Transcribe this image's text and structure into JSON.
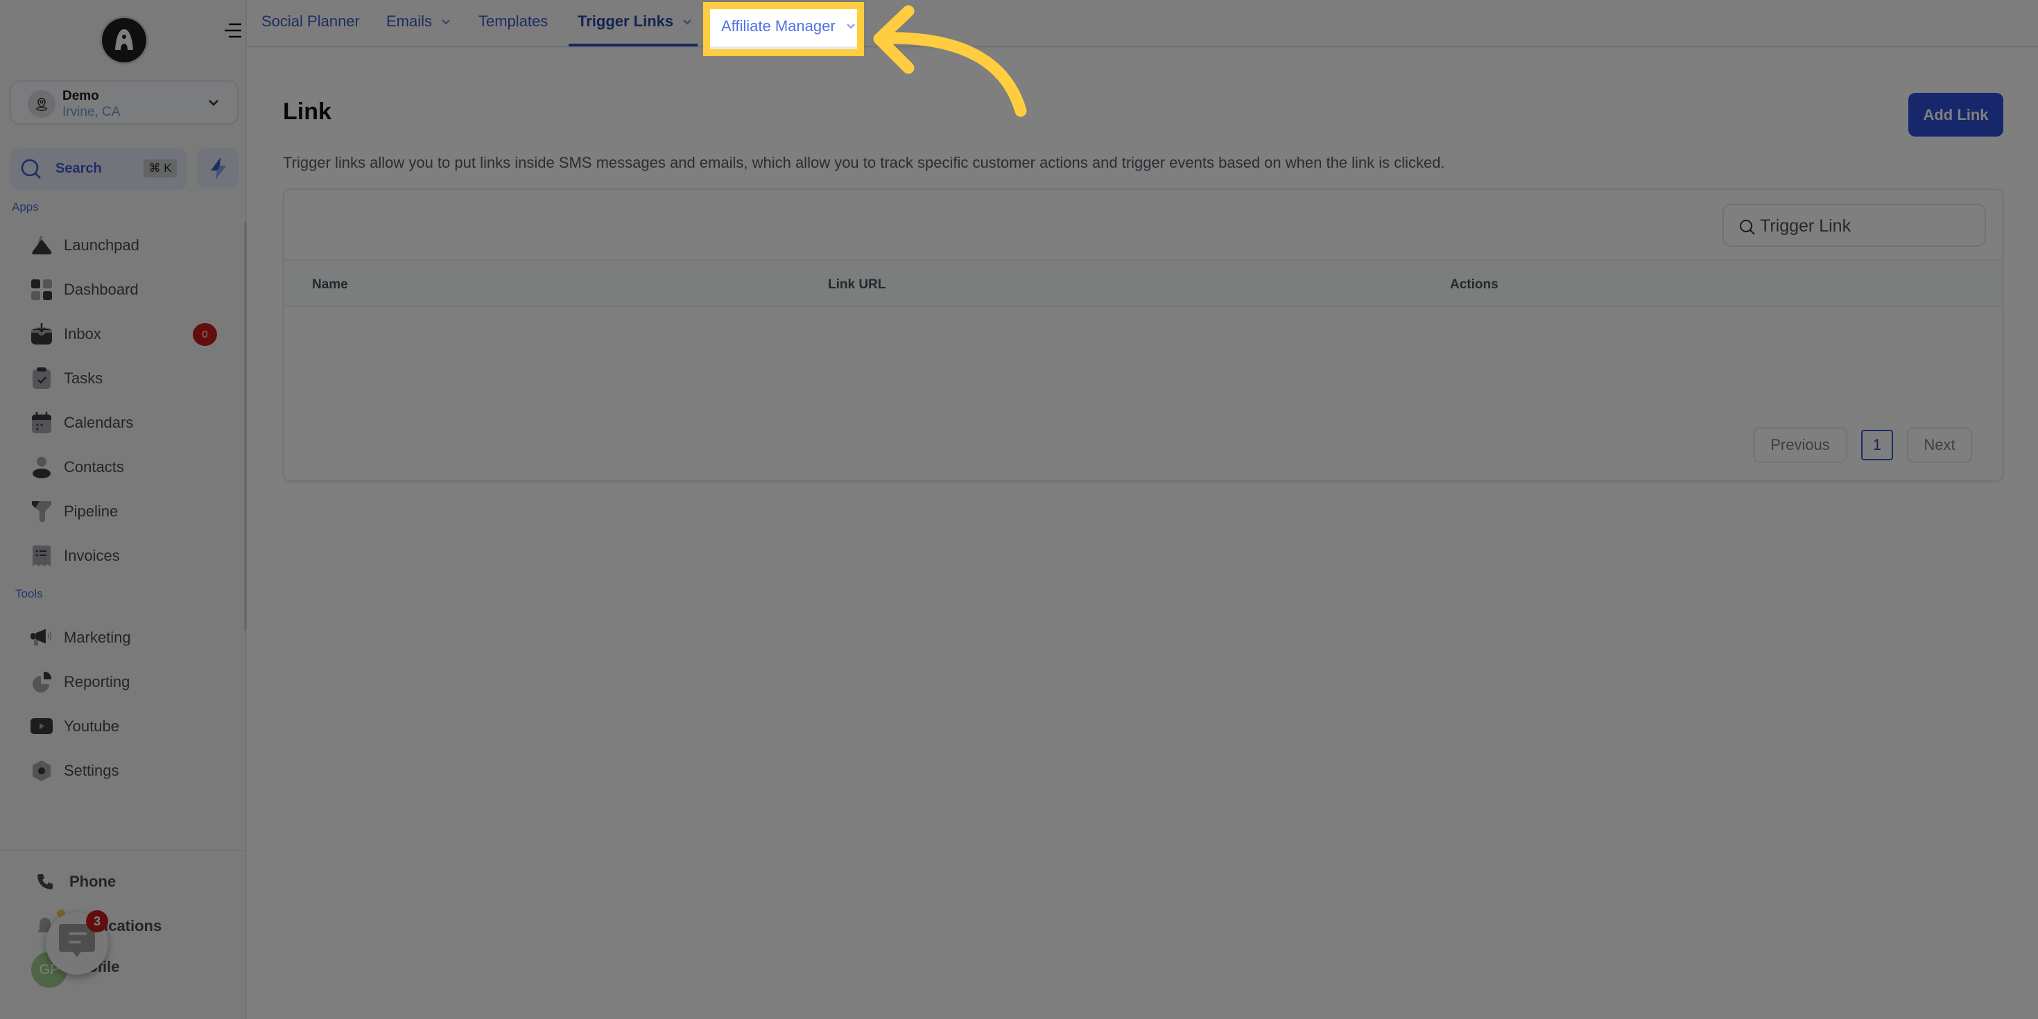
{
  "sidebar": {
    "location": {
      "name": "Demo",
      "city": "Irvine, CA"
    },
    "search": {
      "label": "Search",
      "shortcut": "⌘ K"
    },
    "apps_label": "Apps",
    "tools_label": "Tools",
    "apps": [
      {
        "label": "Launchpad",
        "icon": "launchpad-icon"
      },
      {
        "label": "Dashboard",
        "icon": "dashboard-icon"
      },
      {
        "label": "Inbox",
        "icon": "inbox-icon",
        "badge": "0"
      },
      {
        "label": "Tasks",
        "icon": "tasks-icon"
      },
      {
        "label": "Calendars",
        "icon": "calendar-icon"
      },
      {
        "label": "Contacts",
        "icon": "contacts-icon"
      },
      {
        "label": "Pipeline",
        "icon": "pipeline-icon"
      },
      {
        "label": "Invoices",
        "icon": "invoices-icon"
      }
    ],
    "tools": [
      {
        "label": "Marketing",
        "icon": "megaphone-icon"
      },
      {
        "label": "Reporting",
        "icon": "pie-chart-icon"
      },
      {
        "label": "Youtube",
        "icon": "youtube-icon"
      },
      {
        "label": "Settings",
        "icon": "gear-icon"
      }
    ],
    "bottom": [
      {
        "label": "Phone",
        "icon": "phone-icon"
      },
      {
        "label": "Notifications",
        "icon": "bell-icon"
      },
      {
        "label": "Profile",
        "avatar_initials": "GP"
      }
    ],
    "chat_badge": "3"
  },
  "topnav": {
    "tabs": [
      {
        "label": "Social Planner",
        "has_dropdown": false
      },
      {
        "label": "Emails",
        "has_dropdown": true
      },
      {
        "label": "Templates",
        "has_dropdown": false
      },
      {
        "label": "Trigger Links",
        "has_dropdown": true,
        "active": true
      },
      {
        "label": "Affiliate Manager",
        "has_dropdown": true,
        "highlighted": true
      }
    ]
  },
  "main": {
    "title": "Link",
    "description": "Trigger links allow you to put links inside SMS messages and emails, which allow you to track specific customer actions and trigger events based on when the link is clicked.",
    "add_button": "Add Link",
    "table": {
      "search_placeholder": "Trigger Link",
      "columns": [
        "Name",
        "Link URL",
        "Actions"
      ],
      "rows": []
    },
    "pagination": {
      "previous": "Previous",
      "current_page": "1",
      "next": "Next"
    }
  },
  "colors": {
    "accent": "#2e4fd6",
    "highlight": "#ffcd3f",
    "badge": "#c61d1d"
  }
}
